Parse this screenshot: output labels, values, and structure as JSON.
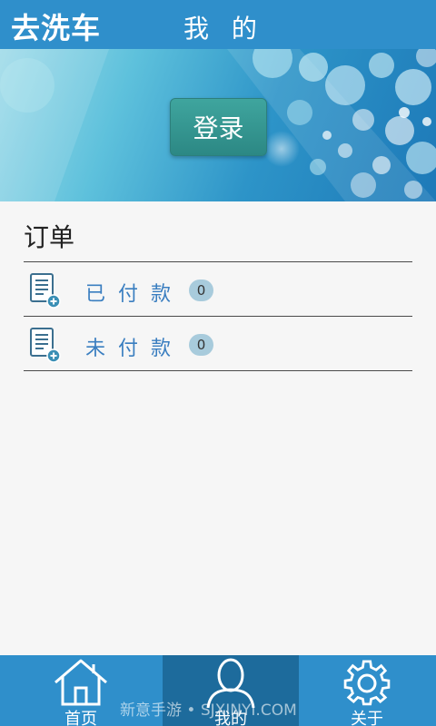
{
  "header": {
    "brand": "去洗车",
    "title": "我 的"
  },
  "banner": {
    "login_label": "登录"
  },
  "orders": {
    "title": "订单",
    "rows": [
      {
        "label": "已付款",
        "count": "0",
        "icon": "document-add-icon"
      },
      {
        "label": "未付款",
        "count": "0",
        "icon": "document-add-icon"
      }
    ]
  },
  "bottom_nav": {
    "items": [
      {
        "label": "首页",
        "icon": "home-icon",
        "active": false
      },
      {
        "label": "我的",
        "icon": "user-icon",
        "active": true
      },
      {
        "label": "关于",
        "icon": "gear-icon",
        "active": false
      }
    ]
  },
  "watermark": "新意手游 • SJXINYI.COM",
  "colors": {
    "primary": "#2f8fcb",
    "nav_active": "#1d6b9c",
    "login_button": "#339893",
    "row_text": "#3a7ec0",
    "badge": "#a8cbdc",
    "background": "#f6f6f6"
  }
}
